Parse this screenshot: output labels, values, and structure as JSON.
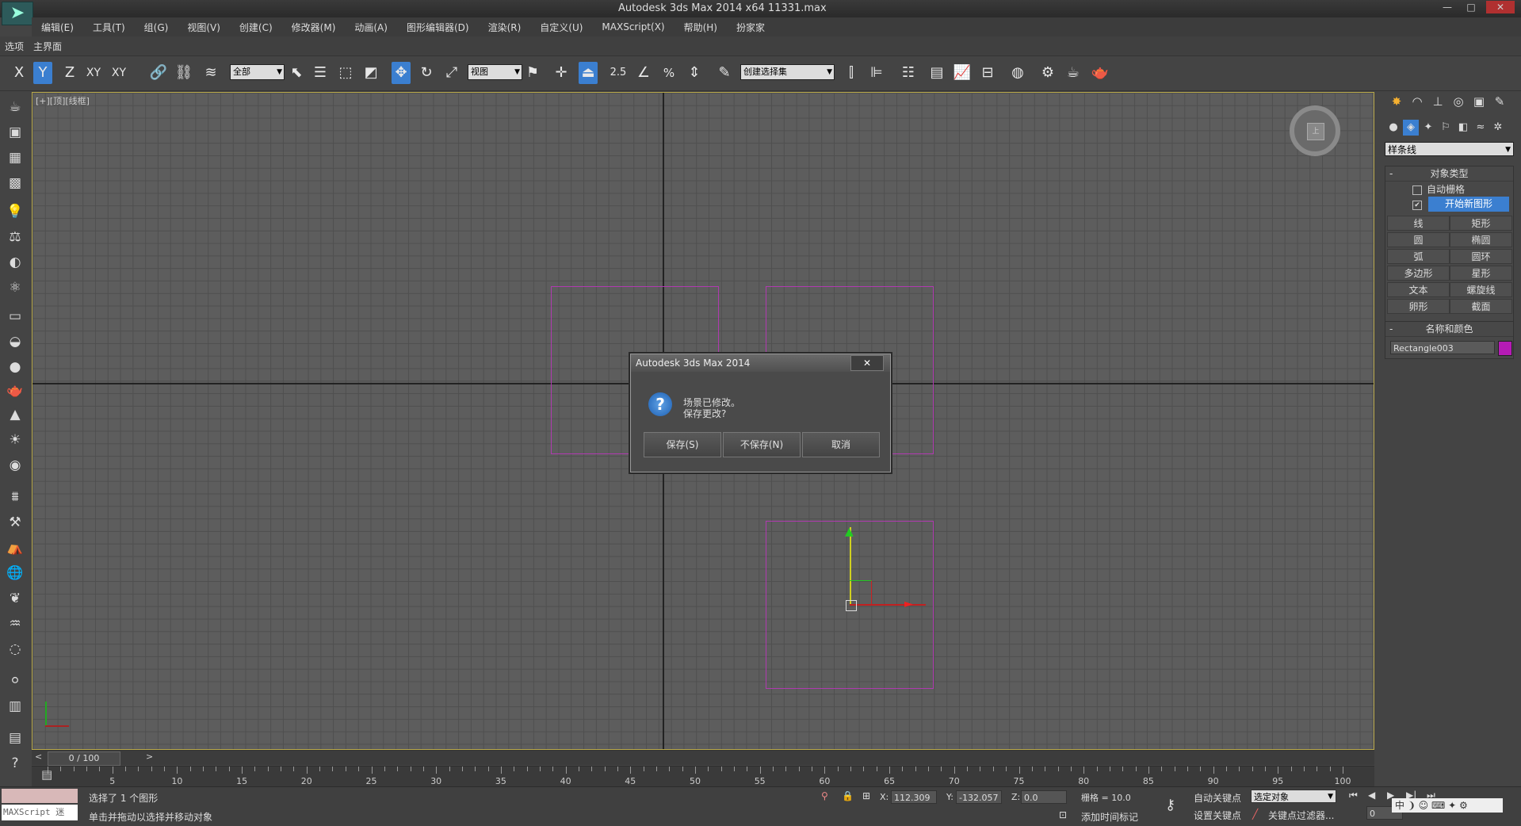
{
  "window": {
    "title": "Autodesk 3ds Max  2014 x64     11331.max",
    "min_icon": "minimize-icon",
    "max_icon": "maximize-icon",
    "close_icon": "close-icon"
  },
  "menu": [
    "编辑(E)",
    "工具(T)",
    "组(G)",
    "视图(V)",
    "创建(C)",
    "修改器(M)",
    "动画(A)",
    "图形编辑器(D)",
    "渲染(R)",
    "自定义(U)",
    "MAXScript(X)",
    "帮助(H)",
    "扮家家"
  ],
  "subbar": [
    "选项",
    "主界面"
  ],
  "toolbar": {
    "axis_x": "X",
    "axis_y": "Y",
    "axis_z": "Z",
    "axis_xy": "XY",
    "axis_xyz": "XY",
    "filter_value": "全部",
    "refcoord_value": "视图",
    "snap_value": "2.5",
    "selection_set_value": "创建选择集"
  },
  "viewport": {
    "label": "[+][顶][线框]",
    "cube_label": "上"
  },
  "dialog": {
    "title": "Autodesk 3ds Max 2014",
    "close": "✕",
    "icon": "question-icon",
    "message_line1": "场景已修改。",
    "message_line2": "保存更改?",
    "save": "保存(S)",
    "dont_save": "不保存(N)",
    "cancel": "取消"
  },
  "command_panel": {
    "category_value": "样条线",
    "object_type_title": "对象类型",
    "auto_grid_label": "自动栅格",
    "auto_grid_checked": false,
    "start_new_shape_checked": true,
    "start_new_shape_label": "开始新图形",
    "buttons": [
      "线",
      "矩形",
      "圆",
      "椭圆",
      "弧",
      "圆环",
      "多边形",
      "星形",
      "文本",
      "螺旋线",
      "卵形",
      "截面"
    ],
    "name_color_title": "名称和颜色",
    "object_name": "Rectangle003",
    "object_color": "#b51bb5"
  },
  "timeline": {
    "slider_text": "0 / 100",
    "prev": "<",
    "next": ">",
    "ticks": [
      "5",
      "10",
      "15",
      "20",
      "25",
      "30",
      "35",
      "40",
      "45",
      "50",
      "55",
      "60",
      "65",
      "70",
      "75",
      "80",
      "85",
      "90",
      "95",
      "100"
    ]
  },
  "status": {
    "maxscript": "MAXScript 迷",
    "selection": "选择了 1 个图形",
    "prompt": "单击并拖动以选择并移动对象",
    "x_label": "X:",
    "x_value": "112.309",
    "y_label": "Y:",
    "y_value": "-132.057",
    "z_label": "Z:",
    "z_value": "0.0",
    "grid": "栅格 = 10.0",
    "add_time_tag": "添加时间标记",
    "auto_key": "自动关键点",
    "set_key": "设置关键点",
    "key_mode_value": "选定对象",
    "key_filters": "关键点过滤器...",
    "frame_value": "0"
  }
}
